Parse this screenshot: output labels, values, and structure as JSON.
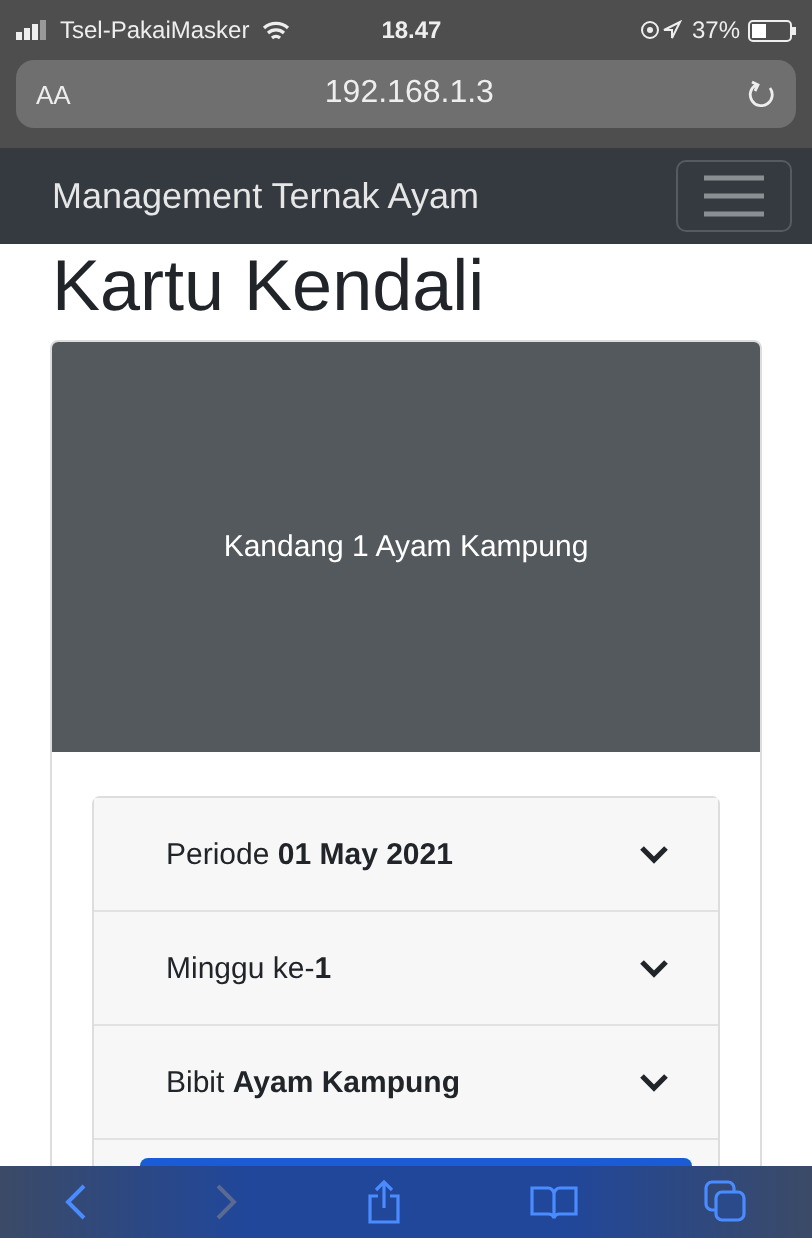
{
  "status_bar": {
    "carrier": "Tsel-PakaiMasker",
    "time": "18.47",
    "battery": "37%"
  },
  "address_bar": {
    "text_size": "AA",
    "url": "192.168.1.3"
  },
  "navbar": {
    "brand": "Management Ternak Ayam"
  },
  "page_title": "Kartu Kendali",
  "card": {
    "header": "Kandang 1 Ayam Kampung",
    "accordion": [
      {
        "label": "Periode **01 May 2021**",
        "expanded": false
      },
      {
        "label": "Minggu ke-**1**",
        "expanded": false
      },
      {
        "label": "Bibit **Ayam Kampung**",
        "expanded": false
      }
    ]
  }
}
